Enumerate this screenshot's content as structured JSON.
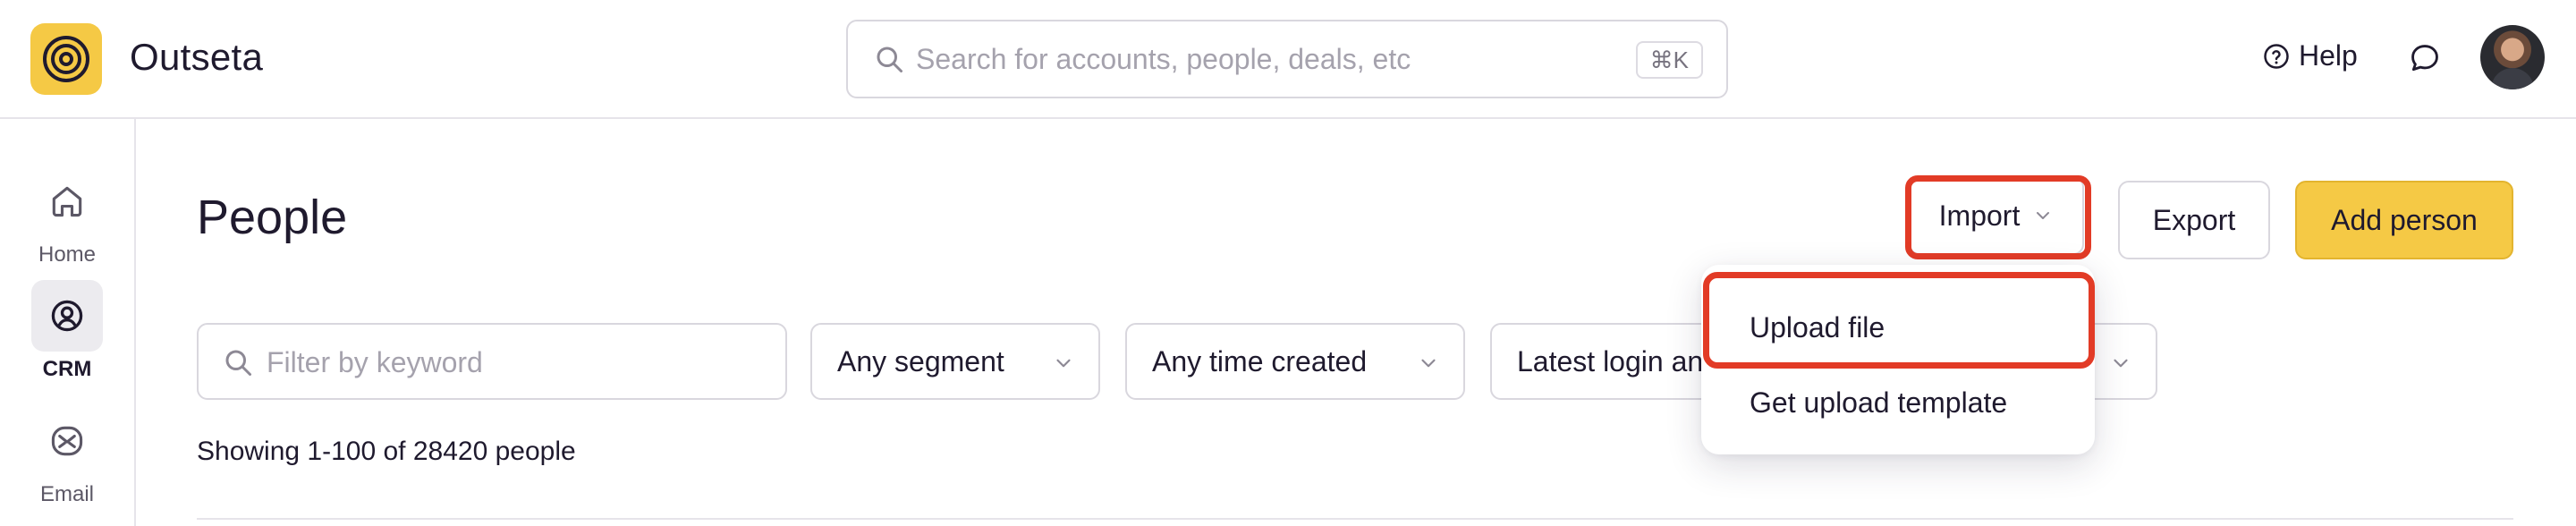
{
  "app": {
    "name": "Outseta",
    "brand_color": "#f5c945",
    "accent_highlight": "#e23b26"
  },
  "header": {
    "search": {
      "placeholder": "Search for accounts, people, deals, etc",
      "value": "",
      "shortcut": "⌘K"
    },
    "help_label": "Help",
    "icons": [
      "help-circle-icon",
      "chat-bubble-icon"
    ]
  },
  "sidebar": {
    "items": [
      {
        "label": "Home",
        "icon": "home-icon",
        "active": false
      },
      {
        "label": "CRM",
        "icon": "person-circle-icon",
        "active": true
      },
      {
        "label": "Email",
        "icon": "envelope-icon",
        "active": false
      }
    ]
  },
  "main": {
    "title": "People",
    "actions": {
      "import_label": "Import",
      "export_label": "Export",
      "add_label": "Add person"
    },
    "filters": {
      "keyword_placeholder": "Filter by keyword",
      "segment": "Any segment",
      "time_created": "Any time created",
      "login": "Latest login and activity"
    },
    "showing_text": "Showing 1-100 of 28420 people"
  },
  "import_menu": {
    "items": [
      {
        "label": "Upload file"
      },
      {
        "label": "Get upload template"
      }
    ]
  }
}
